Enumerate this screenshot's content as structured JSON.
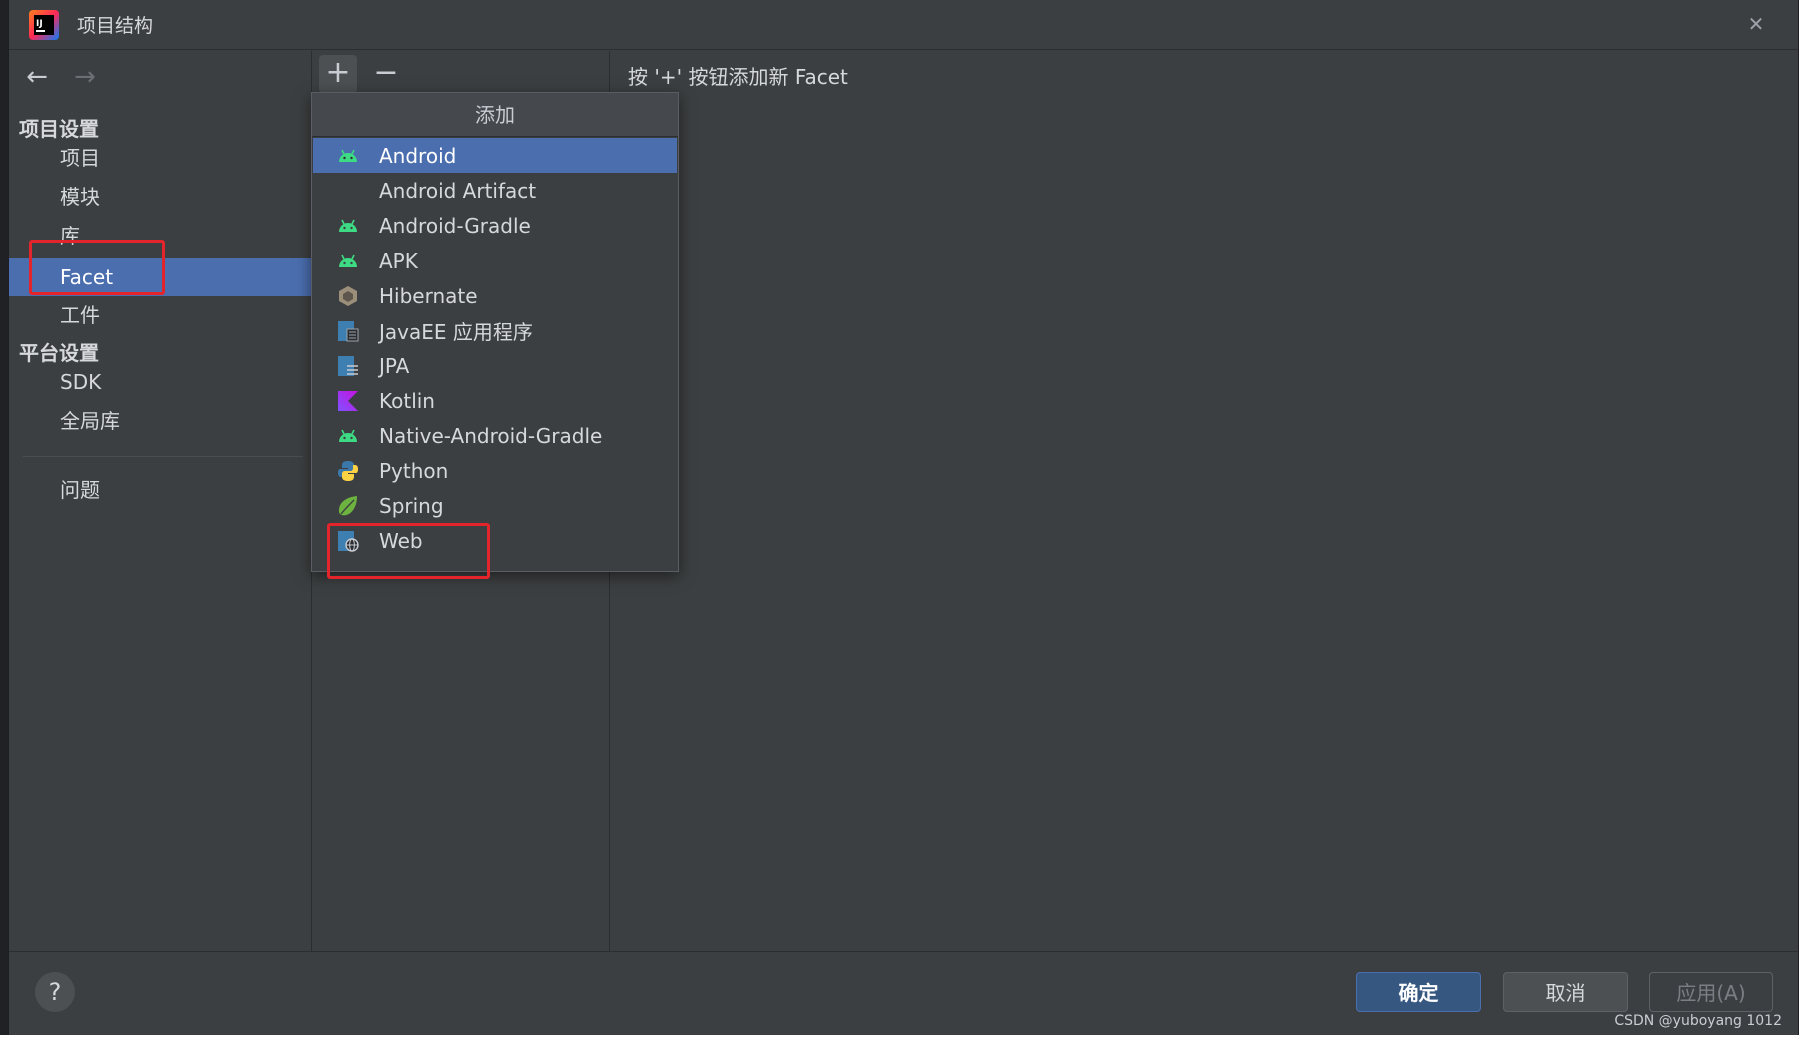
{
  "window": {
    "title": "项目结构"
  },
  "nav": {
    "back_icon": "arrow-left-icon",
    "forward_icon": "arrow-right-icon",
    "sections": [
      {
        "label": "项目设置",
        "items": [
          "项目",
          "模块",
          "库",
          "Facet",
          "工件"
        ]
      },
      {
        "label": "平台设置",
        "items": [
          "SDK",
          "全局库"
        ]
      }
    ],
    "bottom_items": [
      "问题"
    ],
    "selected": "Facet"
  },
  "toolbar": {
    "add_icon": "+",
    "remove_icon": "−"
  },
  "content": {
    "hint": "按 '+' 按钮添加新 Facet"
  },
  "popup": {
    "title": "添加",
    "items": [
      {
        "label": "Android",
        "icon": "android-icon",
        "active": true
      },
      {
        "label": "Android Artifact",
        "icon": "",
        "active": false
      },
      {
        "label": "Android-Gradle",
        "icon": "android-icon",
        "active": false
      },
      {
        "label": "APK",
        "icon": "android-icon",
        "active": false
      },
      {
        "label": "Hibernate",
        "icon": "hibernate-icon",
        "active": false
      },
      {
        "label": "JavaEE 应用程序",
        "icon": "javaee-icon",
        "active": false
      },
      {
        "label": "JPA",
        "icon": "jpa-icon",
        "active": false
      },
      {
        "label": "Kotlin",
        "icon": "kotlin-icon",
        "active": false
      },
      {
        "label": "Native-Android-Gradle",
        "icon": "android-icon",
        "active": false
      },
      {
        "label": "Python",
        "icon": "python-icon",
        "active": false
      },
      {
        "label": "Spring",
        "icon": "spring-icon",
        "active": false
      },
      {
        "label": "Web",
        "icon": "web-icon",
        "active": false
      }
    ]
  },
  "footer": {
    "help": "?",
    "ok": "确定",
    "cancel": "取消",
    "apply": "应用(A)",
    "watermark": "CSDN @yuboyang 1012"
  },
  "colors": {
    "accent": "#4b6eaf",
    "background": "#3c3f41",
    "annotation": "#e3242b",
    "android_green": "#3ddc84"
  }
}
